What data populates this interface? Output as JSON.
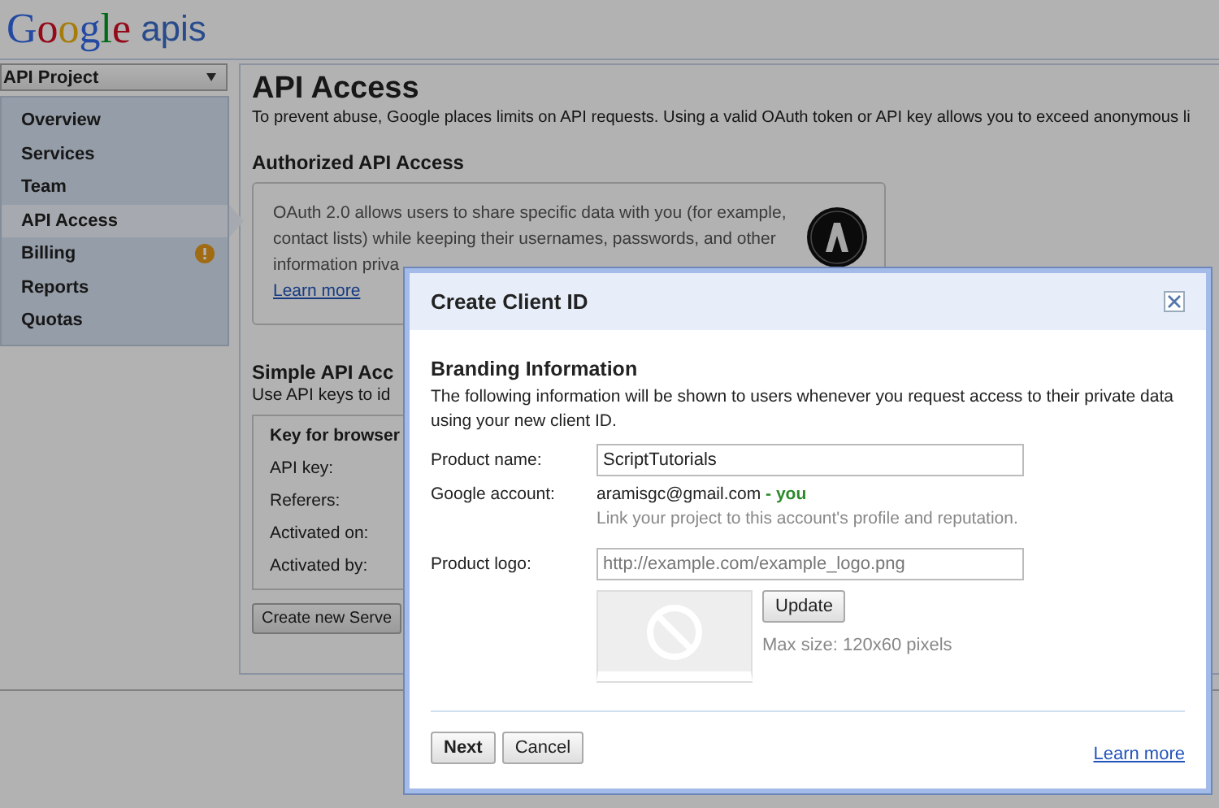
{
  "header": {
    "logo_word": "Google",
    "logo_suffix": "apis"
  },
  "sidebar": {
    "project": "API Project",
    "items": [
      {
        "label": "Overview",
        "selected": false,
        "alert": false
      },
      {
        "label": "Services",
        "selected": false,
        "alert": false
      },
      {
        "label": "Team",
        "selected": false,
        "alert": false
      },
      {
        "label": "API Access",
        "selected": true,
        "alert": false
      },
      {
        "label": "Billing",
        "selected": false,
        "alert": true
      },
      {
        "label": "Reports",
        "selected": false,
        "alert": false
      },
      {
        "label": "Quotas",
        "selected": false,
        "alert": false
      }
    ]
  },
  "main": {
    "title": "API Access",
    "intro": "To prevent abuse, Google places limits on API requests. Using a valid OAuth token or API key allows you to exceed anonymous li",
    "authorized": {
      "heading": "Authorized API Access",
      "lines": [
        "OAuth 2.0 allows users to share specific data with you (for example,",
        "contact lists) while keeping their usernames, passwords, and other",
        "information priva"
      ],
      "link": "Learn more"
    },
    "simple": {
      "heading": "Simple API Acc",
      "text": "Use API keys to id",
      "key_title": "Key for browser",
      "fields": [
        "API key:",
        "Referers:",
        "Activated on:",
        "Activated by:"
      ],
      "button": "Create new Serve"
    }
  },
  "dialog": {
    "title": "Create Client ID",
    "section": "Branding Information",
    "description": "The following information will be shown to users whenever you request access to their private data using your new client ID.",
    "product_name": {
      "label": "Product name:",
      "value": "ScriptTutorials"
    },
    "account": {
      "label": "Google account:",
      "email": "aramisgc@gmail.com",
      "you": "- you",
      "hint": "Link your project to this account's profile and reputation."
    },
    "logo": {
      "label": "Product logo:",
      "placeholder": "http://example.com/example_logo.png",
      "update": "Update",
      "max_size": "Max size: 120x60 pixels"
    },
    "buttons": [
      "Next",
      "Cancel"
    ],
    "link": "Learn more"
  }
}
